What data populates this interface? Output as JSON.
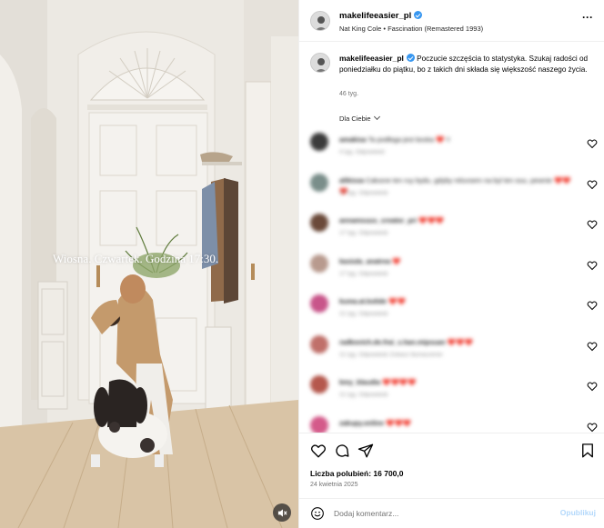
{
  "media": {
    "overlay_text": "Wiosna. Czwartek. Godzina 17:30."
  },
  "header": {
    "username": "makelifeeasier_pl",
    "music": "Nat King Cole • Fascination (Remastered 1993)"
  },
  "caption": {
    "username": "makelifeeasier_pl",
    "text": "Poczucie szczęścia to statystyka. Szukaj radości od poniedziałku do piątku, bo z takich dni składa się większość naszego życia.",
    "time": "46 tyg."
  },
  "filter": {
    "label": "Dla Ciebie"
  },
  "comments": [
    {
      "user": "amakisa",
      "text": "Ta podłoga jest boska ❤️ !!",
      "meta": "4 tyg.   Odpowiedz",
      "avatar_color": "#3b3b3b"
    },
    {
      "user": "alikissa",
      "text": "Całusne ten ruy bydu, gdyby reluvsem na byl ten ouu, pewnie ❤️❤️❤️",
      "meta": "17 tyg.   Odpowiedz",
      "avatar_color": "#7a8e8a"
    },
    {
      "user": "annamsuus_creator_pri",
      "text": "❤️❤️❤️",
      "meta": "17 tyg.   Odpowiedz",
      "avatar_color": "#6b4a3a"
    },
    {
      "user": "kasiula_anatrea",
      "text": "❤️",
      "meta": "17 tyg.   Odpowiedz",
      "avatar_color": "#b89a8e"
    },
    {
      "user": "kuma.at.kolide",
      "text": "❤️❤️",
      "meta": "21 tyg.   Odpowiedz",
      "avatar_color": "#c8558a"
    },
    {
      "user": "radkovich.de.frai_s.han.mipsuan",
      "text": "❤️❤️❤️",
      "meta": "21 tyg.   Odpowiedz   Zobacz tłumaczenie",
      "avatar_color": "#c0706a"
    },
    {
      "user": "kmy_klaudia",
      "text": "❤️❤️❤️❤️",
      "meta": "21 tyg.   Odpowiedz",
      "avatar_color": "#b5584d"
    },
    {
      "user": "zakupy.online",
      "text": "❤️❤️❤️",
      "meta": "",
      "avatar_color": "#d45a8a"
    }
  ],
  "actions": {
    "likes": "Liczba polubień: 16 700,0",
    "date": "24 kwietnia 2025"
  },
  "add_comment": {
    "placeholder": "Dodaj komentarz...",
    "publish_label": "Opublikuj"
  },
  "colors": {
    "verified": "#3897f0",
    "publish_disabled": "#b3d8fb",
    "muted_text": "#737373"
  }
}
